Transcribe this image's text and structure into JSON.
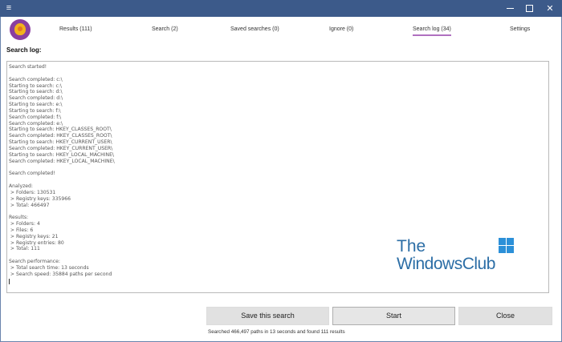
{
  "window": {
    "menu_icon": "hamburger-icon",
    "minimize_icon": "minimize-icon",
    "maximize_icon": "maximize-icon",
    "close_glyph": "✕",
    "menu_glyph": "≡"
  },
  "colors": {
    "titlebar": "#3c5a8a",
    "logo_outer": "#8a3fa0",
    "logo_inner": "#f2b21c",
    "active_tab_underline": "#b070c0",
    "watermark": "#2c6ea6"
  },
  "tabs": [
    {
      "label": "Results (111)",
      "active": false
    },
    {
      "label": "Search (2)",
      "active": false
    },
    {
      "label": "Saved searches (0)",
      "active": false
    },
    {
      "label": "Ignore (0)",
      "active": false
    },
    {
      "label": "Search log (34)",
      "active": true
    },
    {
      "label": "Settings",
      "active": false
    }
  ],
  "section_label": "Search log:",
  "log_lines": [
    "Search started!",
    "",
    "Search completed: c:\\",
    "Starting to search: c:\\",
    "Starting to search: d:\\",
    "Search completed: d:\\",
    "Starting to search: e:\\",
    "Starting to search: f:\\",
    "Search completed: f:\\",
    "Search completed: e:\\",
    "Starting to search: HKEY_CLASSES_ROOT\\",
    "Search completed: HKEY_CLASSES_ROOT\\",
    "Starting to search: HKEY_CURRENT_USER\\",
    "Search completed: HKEY_CURRENT_USER\\",
    "Starting to search: HKEY_LOCAL_MACHINE\\",
    "Search completed: HKEY_LOCAL_MACHINE\\",
    "",
    "Search completed!",
    "",
    "Analyzed:",
    " > Folders: 130531",
    " > Registry keys: 335966",
    " > Total: 466497",
    "",
    "Results:",
    " > Folders: 4",
    " > Files: 6",
    " > Registry keys: 21",
    " > Registry entries: 80",
    " > Total: 111",
    "",
    "Search performance:",
    " > Total search time: 13 seconds",
    " > Search speed: 35884 paths per second"
  ],
  "watermark": {
    "line1": "The",
    "line2": "WindowsClub"
  },
  "buttons": {
    "save": "Save this search",
    "start": "Start",
    "close": "Close"
  },
  "status_text": "Searched 466,497 paths in 13 seconds and found 111 results"
}
